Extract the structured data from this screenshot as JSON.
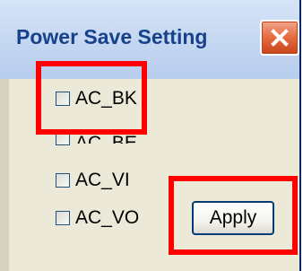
{
  "window": {
    "title": "Power Save Setting",
    "close_icon": "close-icon"
  },
  "checkboxes": [
    {
      "label": "AC_BK",
      "checked": false
    },
    {
      "label": "AC_BE",
      "checked": false
    },
    {
      "label": "AC_VI",
      "checked": false
    },
    {
      "label": "AC_VO",
      "checked": false
    }
  ],
  "buttons": {
    "apply_label": "Apply"
  },
  "colors": {
    "title_text": "#15428b",
    "close_button": "#e56a3e",
    "annotation": "#ff0000",
    "window_bg": "#ece9d8"
  }
}
